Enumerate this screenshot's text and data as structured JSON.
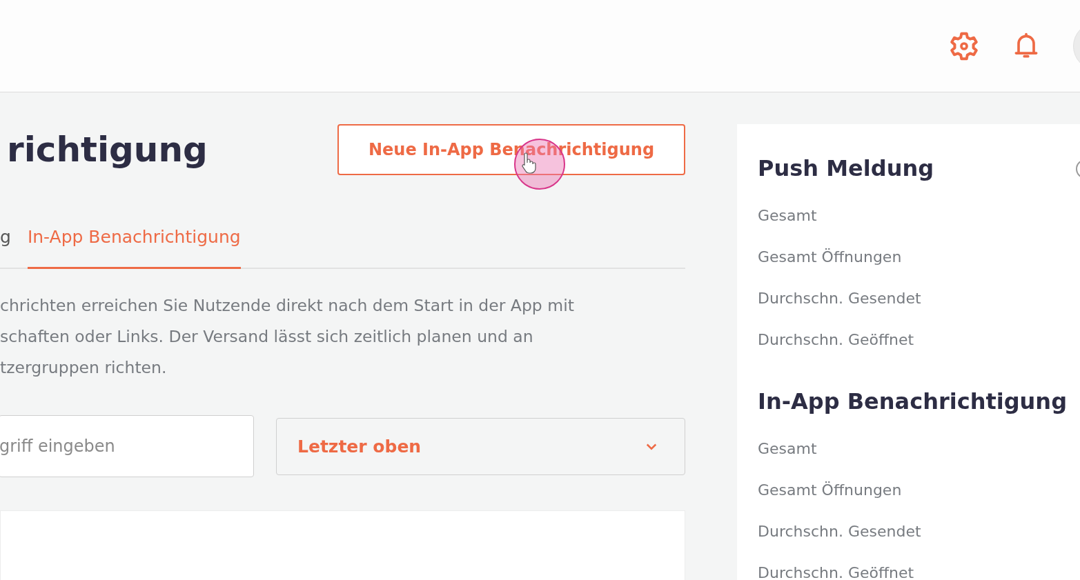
{
  "header": {
    "icons": [
      {
        "kind": "settings"
      },
      {
        "kind": "notifications"
      },
      {
        "kind": "avatar"
      }
    ]
  },
  "page": {
    "title": "richtigung",
    "new_button": "Neue In-App Benachrichtigung"
  },
  "tabs": [
    {
      "label": "g",
      "selected": false
    },
    {
      "label": "In-App Benachrichtigung",
      "selected": true
    }
  ],
  "description": {
    "lines": [
      "chrichten erreichen Sie Nutzende direkt nach dem Start in der App mit",
      "schaften oder Links. Der Versand lässt sich zeitlich planen und an",
      "tzergruppen richten."
    ]
  },
  "search": {
    "placeholder": "griff eingeben"
  },
  "sort": {
    "value": "Letzter oben"
  },
  "stats": [
    {
      "title": "Push Meldung",
      "items": [
        "Gesamt",
        "Gesamt Öffnungen",
        "Durchschn. Gesendet",
        "Durchschn. Geöffnet"
      ]
    },
    {
      "title": "In-App Benachrichtigung",
      "items": [
        "Gesamt",
        "Gesamt Öffnungen",
        "Durchschn. Gesendet",
        "Durchschn. Geöffnet"
      ]
    }
  ]
}
